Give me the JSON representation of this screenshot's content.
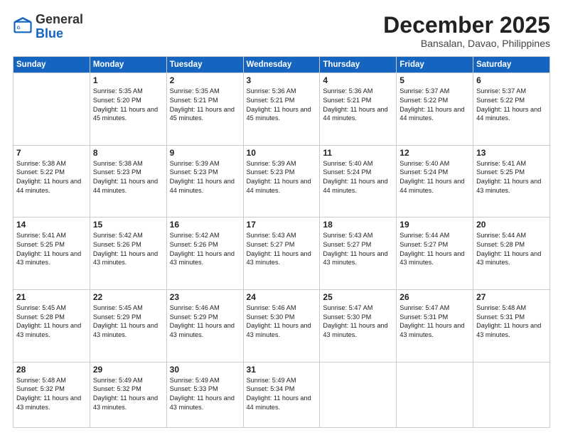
{
  "logo": {
    "general": "General",
    "blue": "Blue"
  },
  "title": "December 2025",
  "subtitle": "Bansalan, Davao, Philippines",
  "weekdays": [
    "Sunday",
    "Monday",
    "Tuesday",
    "Wednesday",
    "Thursday",
    "Friday",
    "Saturday"
  ],
  "weeks": [
    [
      {
        "day": "",
        "info": ""
      },
      {
        "day": "1",
        "info": "Sunrise: 5:35 AM\nSunset: 5:20 PM\nDaylight: 11 hours and 45 minutes."
      },
      {
        "day": "2",
        "info": "Sunrise: 5:35 AM\nSunset: 5:21 PM\nDaylight: 11 hours and 45 minutes."
      },
      {
        "day": "3",
        "info": "Sunrise: 5:36 AM\nSunset: 5:21 PM\nDaylight: 11 hours and 45 minutes."
      },
      {
        "day": "4",
        "info": "Sunrise: 5:36 AM\nSunset: 5:21 PM\nDaylight: 11 hours and 44 minutes."
      },
      {
        "day": "5",
        "info": "Sunrise: 5:37 AM\nSunset: 5:22 PM\nDaylight: 11 hours and 44 minutes."
      },
      {
        "day": "6",
        "info": "Sunrise: 5:37 AM\nSunset: 5:22 PM\nDaylight: 11 hours and 44 minutes."
      }
    ],
    [
      {
        "day": "7",
        "info": "Sunrise: 5:38 AM\nSunset: 5:22 PM\nDaylight: 11 hours and 44 minutes."
      },
      {
        "day": "8",
        "info": "Sunrise: 5:38 AM\nSunset: 5:23 PM\nDaylight: 11 hours and 44 minutes."
      },
      {
        "day": "9",
        "info": "Sunrise: 5:39 AM\nSunset: 5:23 PM\nDaylight: 11 hours and 44 minutes."
      },
      {
        "day": "10",
        "info": "Sunrise: 5:39 AM\nSunset: 5:23 PM\nDaylight: 11 hours and 44 minutes."
      },
      {
        "day": "11",
        "info": "Sunrise: 5:40 AM\nSunset: 5:24 PM\nDaylight: 11 hours and 44 minutes."
      },
      {
        "day": "12",
        "info": "Sunrise: 5:40 AM\nSunset: 5:24 PM\nDaylight: 11 hours and 44 minutes."
      },
      {
        "day": "13",
        "info": "Sunrise: 5:41 AM\nSunset: 5:25 PM\nDaylight: 11 hours and 43 minutes."
      }
    ],
    [
      {
        "day": "14",
        "info": "Sunrise: 5:41 AM\nSunset: 5:25 PM\nDaylight: 11 hours and 43 minutes."
      },
      {
        "day": "15",
        "info": "Sunrise: 5:42 AM\nSunset: 5:26 PM\nDaylight: 11 hours and 43 minutes."
      },
      {
        "day": "16",
        "info": "Sunrise: 5:42 AM\nSunset: 5:26 PM\nDaylight: 11 hours and 43 minutes."
      },
      {
        "day": "17",
        "info": "Sunrise: 5:43 AM\nSunset: 5:27 PM\nDaylight: 11 hours and 43 minutes."
      },
      {
        "day": "18",
        "info": "Sunrise: 5:43 AM\nSunset: 5:27 PM\nDaylight: 11 hours and 43 minutes."
      },
      {
        "day": "19",
        "info": "Sunrise: 5:44 AM\nSunset: 5:27 PM\nDaylight: 11 hours and 43 minutes."
      },
      {
        "day": "20",
        "info": "Sunrise: 5:44 AM\nSunset: 5:28 PM\nDaylight: 11 hours and 43 minutes."
      }
    ],
    [
      {
        "day": "21",
        "info": "Sunrise: 5:45 AM\nSunset: 5:28 PM\nDaylight: 11 hours and 43 minutes."
      },
      {
        "day": "22",
        "info": "Sunrise: 5:45 AM\nSunset: 5:29 PM\nDaylight: 11 hours and 43 minutes."
      },
      {
        "day": "23",
        "info": "Sunrise: 5:46 AM\nSunset: 5:29 PM\nDaylight: 11 hours and 43 minutes."
      },
      {
        "day": "24",
        "info": "Sunrise: 5:46 AM\nSunset: 5:30 PM\nDaylight: 11 hours and 43 minutes."
      },
      {
        "day": "25",
        "info": "Sunrise: 5:47 AM\nSunset: 5:30 PM\nDaylight: 11 hours and 43 minutes."
      },
      {
        "day": "26",
        "info": "Sunrise: 5:47 AM\nSunset: 5:31 PM\nDaylight: 11 hours and 43 minutes."
      },
      {
        "day": "27",
        "info": "Sunrise: 5:48 AM\nSunset: 5:31 PM\nDaylight: 11 hours and 43 minutes."
      }
    ],
    [
      {
        "day": "28",
        "info": "Sunrise: 5:48 AM\nSunset: 5:32 PM\nDaylight: 11 hours and 43 minutes."
      },
      {
        "day": "29",
        "info": "Sunrise: 5:49 AM\nSunset: 5:32 PM\nDaylight: 11 hours and 43 minutes."
      },
      {
        "day": "30",
        "info": "Sunrise: 5:49 AM\nSunset: 5:33 PM\nDaylight: 11 hours and 43 minutes."
      },
      {
        "day": "31",
        "info": "Sunrise: 5:49 AM\nSunset: 5:34 PM\nDaylight: 11 hours and 44 minutes."
      },
      {
        "day": "",
        "info": ""
      },
      {
        "day": "",
        "info": ""
      },
      {
        "day": "",
        "info": ""
      }
    ]
  ]
}
